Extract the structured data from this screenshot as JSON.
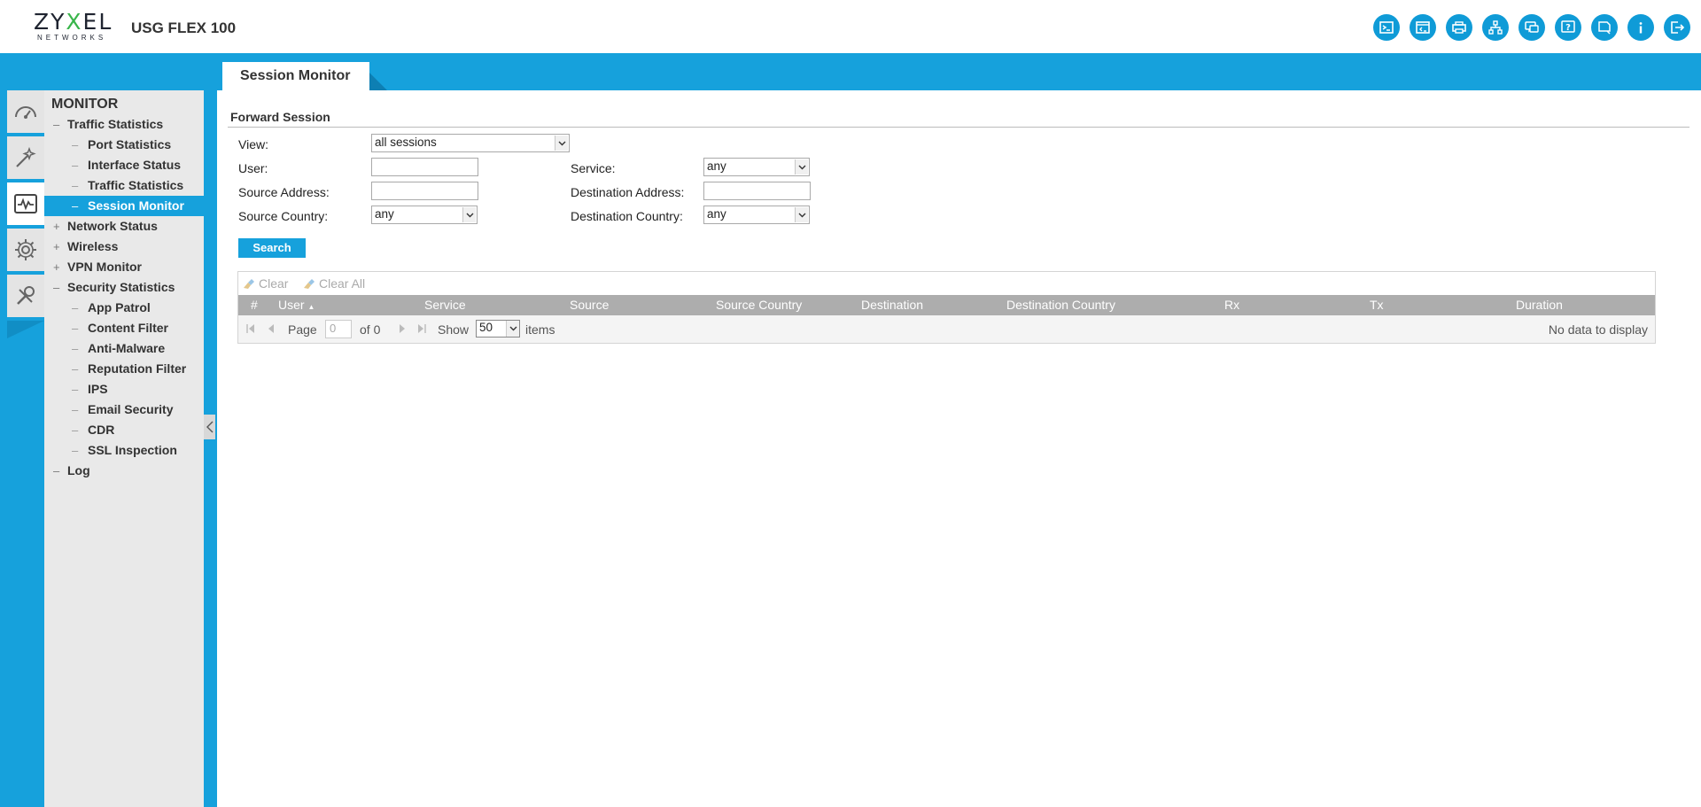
{
  "header": {
    "brand": "ZYXEL",
    "brand_sub": "NETWORKS",
    "model": "USG FLEX 100",
    "icons": [
      "console-icon",
      "cli-icon",
      "print-icon",
      "network-map-icon",
      "message-icon",
      "help-icon",
      "chat-icon",
      "info-icon",
      "logout-icon"
    ]
  },
  "tab": {
    "label": "Session Monitor"
  },
  "rail": [
    "dashboard-icon",
    "wizard-icon",
    "monitor-icon",
    "configuration-icon",
    "maintenance-icon"
  ],
  "nav": {
    "title": "MONITOR",
    "items": [
      {
        "label": "Traffic Statistics",
        "level": 1,
        "sign": "–"
      },
      {
        "label": "Port Statistics",
        "level": 2,
        "sign": "–"
      },
      {
        "label": "Interface Status",
        "level": 2,
        "sign": "–"
      },
      {
        "label": "Traffic Statistics",
        "level": 2,
        "sign": "–"
      },
      {
        "label": "Session Monitor",
        "level": 2,
        "sign": "–",
        "selected": true
      },
      {
        "label": "Network Status",
        "level": 1,
        "sign": "+"
      },
      {
        "label": "Wireless",
        "level": 1,
        "sign": "+"
      },
      {
        "label": "VPN Monitor",
        "level": 1,
        "sign": "+"
      },
      {
        "label": "Security Statistics",
        "level": 1,
        "sign": "–"
      },
      {
        "label": "App Patrol",
        "level": 2,
        "sign": "–"
      },
      {
        "label": "Content Filter",
        "level": 2,
        "sign": "–"
      },
      {
        "label": "Anti-Malware",
        "level": 2,
        "sign": "–"
      },
      {
        "label": "Reputation Filter",
        "level": 2,
        "sign": "–"
      },
      {
        "label": "IPS",
        "level": 2,
        "sign": "–"
      },
      {
        "label": "Email Security",
        "level": 2,
        "sign": "–"
      },
      {
        "label": "CDR",
        "level": 2,
        "sign": "–"
      },
      {
        "label": "SSL Inspection",
        "level": 2,
        "sign": "–"
      },
      {
        "label": "Log",
        "level": 1,
        "sign": "–"
      }
    ]
  },
  "form": {
    "section_title": "Forward Session",
    "view_label": "View:",
    "view_value": "all sessions",
    "user_label": "User:",
    "user_value": "",
    "service_label": "Service:",
    "service_value": "any",
    "source_address_label": "Source Address:",
    "source_address_value": "",
    "destination_address_label": "Destination Address:",
    "destination_address_value": "",
    "source_country_label": "Source Country:",
    "source_country_value": "any",
    "destination_country_label": "Destination Country:",
    "destination_country_value": "any",
    "search_label": "Search"
  },
  "grid": {
    "clear_label": "Clear",
    "clear_all_label": "Clear All",
    "columns": [
      "#",
      "User",
      "Service",
      "Source",
      "Source Country",
      "Destination",
      "Destination Country",
      "Rx",
      "Tx",
      "Duration"
    ],
    "sort_column": "User",
    "pager": {
      "page_label": "Page",
      "page_value": "0",
      "of_label": "of 0",
      "show_label": "Show",
      "page_size": "50",
      "items_label": "items",
      "empty_text": "No data to display"
    }
  },
  "colors": {
    "accent": "#16a1dc",
    "nav_bg": "#e9e9e9",
    "grid_header": "#adadad"
  }
}
